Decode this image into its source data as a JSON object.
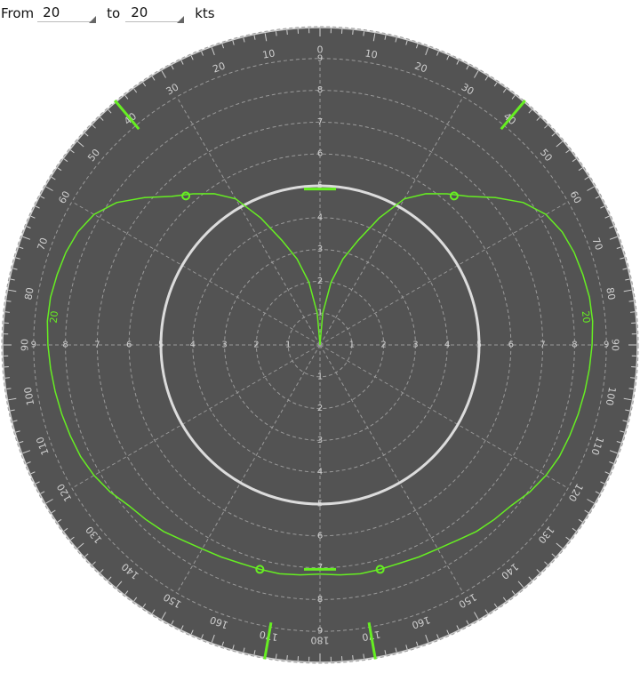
{
  "controls": {
    "from_label": "From",
    "from_value": "20",
    "to_label": "to",
    "to_value": "20",
    "unit_label": "kts"
  },
  "colors": {
    "dial": "#535353",
    "polar_curve": "#66ee22",
    "ring": "#dcdcdc",
    "grid": "#9a9a9a",
    "ticks": "#cfcfcf"
  },
  "chart_data": {
    "type": "line",
    "coordinate_system": "polar",
    "title": "",
    "speed_rings": [
      1,
      2,
      3,
      4,
      5,
      6,
      7,
      8,
      9,
      10
    ],
    "speed_ring_labels": [
      "1",
      "2",
      "3",
      "4",
      "5",
      "6",
      "7",
      "8",
      "9"
    ],
    "angle_labels": [
      "0",
      "10",
      "20",
      "30",
      "40",
      "50",
      "60",
      "70",
      "80",
      "90",
      "100",
      "110",
      "120",
      "130",
      "140",
      "150",
      "160",
      "170",
      "180"
    ],
    "highlight_ring": 5,
    "series": [
      {
        "name": "20",
        "points": [
          {
            "twa": 0,
            "speed": 0.0
          },
          {
            "twa": 5,
            "speed": 1.0
          },
          {
            "twa": 10,
            "speed": 2.0
          },
          {
            "twa": 15,
            "speed": 2.8
          },
          {
            "twa": 20,
            "speed": 3.5
          },
          {
            "twa": 25,
            "speed": 4.4
          },
          {
            "twa": 30,
            "speed": 5.3
          },
          {
            "twa": 35,
            "speed": 5.8
          },
          {
            "twa": 40,
            "speed": 6.2
          },
          {
            "twa": 45,
            "speed": 6.6
          },
          {
            "twa": 50,
            "speed": 7.2
          },
          {
            "twa": 55,
            "speed": 7.8
          },
          {
            "twa": 60,
            "speed": 8.2
          },
          {
            "twa": 65,
            "speed": 8.4
          },
          {
            "twa": 70,
            "speed": 8.5
          },
          {
            "twa": 75,
            "speed": 8.55
          },
          {
            "twa": 80,
            "speed": 8.6
          },
          {
            "twa": 85,
            "speed": 8.6
          },
          {
            "twa": 90,
            "speed": 8.55
          },
          {
            "twa": 95,
            "speed": 8.5
          },
          {
            "twa": 100,
            "speed": 8.45
          },
          {
            "twa": 105,
            "speed": 8.4
          },
          {
            "twa": 110,
            "speed": 8.35
          },
          {
            "twa": 115,
            "speed": 8.3
          },
          {
            "twa": 120,
            "speed": 8.2
          },
          {
            "twa": 125,
            "speed": 8.05
          },
          {
            "twa": 130,
            "speed": 7.85
          },
          {
            "twa": 135,
            "speed": 7.75
          },
          {
            "twa": 140,
            "speed": 7.65
          },
          {
            "twa": 145,
            "speed": 7.5
          },
          {
            "twa": 150,
            "speed": 7.4
          },
          {
            "twa": 155,
            "speed": 7.35
          },
          {
            "twa": 160,
            "speed": 7.3
          },
          {
            "twa": 165,
            "speed": 7.3
          },
          {
            "twa": 170,
            "speed": 7.3
          },
          {
            "twa": 175,
            "speed": 7.25
          },
          {
            "twa": 180,
            "speed": 7.2
          }
        ]
      }
    ],
    "curve_labels": [
      {
        "text": "20",
        "twa": 84,
        "speed": 8.4
      }
    ],
    "optimal_markers": [
      {
        "twa": 42,
        "speed": 6.3,
        "note": "best VMG upwind"
      },
      {
        "twa": 165,
        "speed": 7.3,
        "note": "best VMG downwind"
      }
    ],
    "vmg_bars": [
      {
        "speed": 4.9
      },
      {
        "speed": 7.05
      }
    ],
    "angle_ticks": [
      {
        "twa": 40,
        "note": "upwind tack angle"
      },
      {
        "twa": 170,
        "note": "downwind gybe angle"
      }
    ]
  }
}
